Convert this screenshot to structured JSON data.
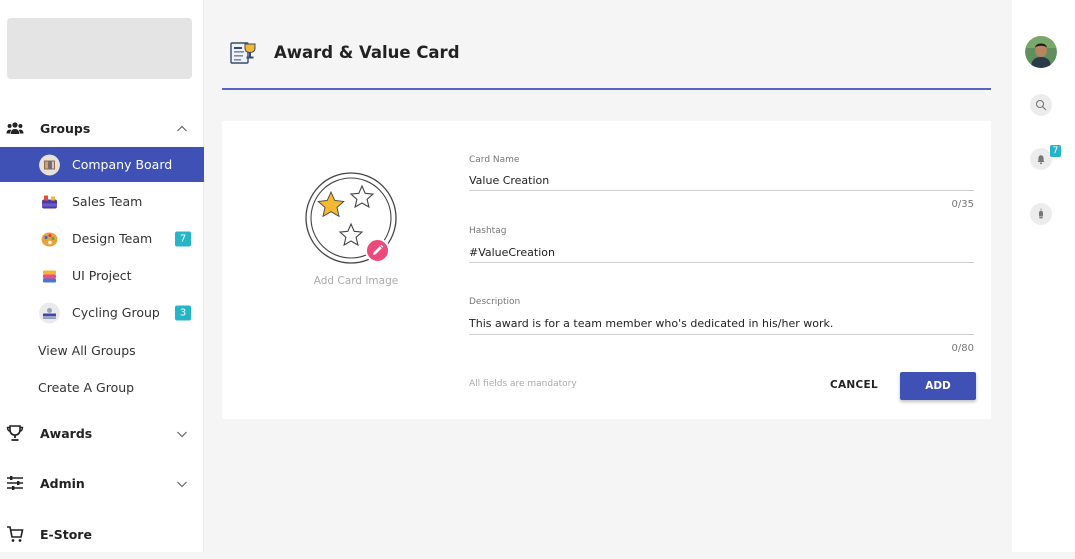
{
  "sidebar": {
    "groups_label": "Groups",
    "groups": [
      {
        "label": "Company Board",
        "active": true,
        "badge": ""
      },
      {
        "label": "Sales Team",
        "active": false,
        "badge": ""
      },
      {
        "label": "Design Team",
        "active": false,
        "badge": "7"
      },
      {
        "label": "UI Project",
        "active": false,
        "badge": ""
      },
      {
        "label": "Cycling Group",
        "active": false,
        "badge": "3"
      }
    ],
    "view_all": "View All Groups",
    "create_group": "Create A Group",
    "awards_label": "Awards",
    "admin_label": "Admin",
    "estore_label": "E-Store"
  },
  "header": {
    "title": "Award & Value Card"
  },
  "form": {
    "add_image_caption": "Add Card Image",
    "card_name": {
      "label": "Card Name",
      "value": "Value Creation",
      "counter": "0/35"
    },
    "hashtag": {
      "label": "Hashtag",
      "value": "#ValueCreation"
    },
    "description": {
      "label": "Description",
      "value": "This award is for a team member who's dedicated in his/her work.",
      "counter": "0/80"
    },
    "mandatory_note": "All fields are mandatory",
    "cancel_label": "CANCEL",
    "add_label": "ADD"
  },
  "rail": {
    "notification_count": "7"
  },
  "colors": {
    "accent": "#3f51b5",
    "badge": "#26b5c8",
    "edit": "#ec4a7a",
    "star": "#f5b82e"
  },
  "icons": [
    "groups-icon",
    "trophy-icon",
    "sliders-icon",
    "cart-icon",
    "search-icon",
    "bell-icon",
    "lightbulb-icon",
    "pencil-icon",
    "award-card-icon"
  ]
}
